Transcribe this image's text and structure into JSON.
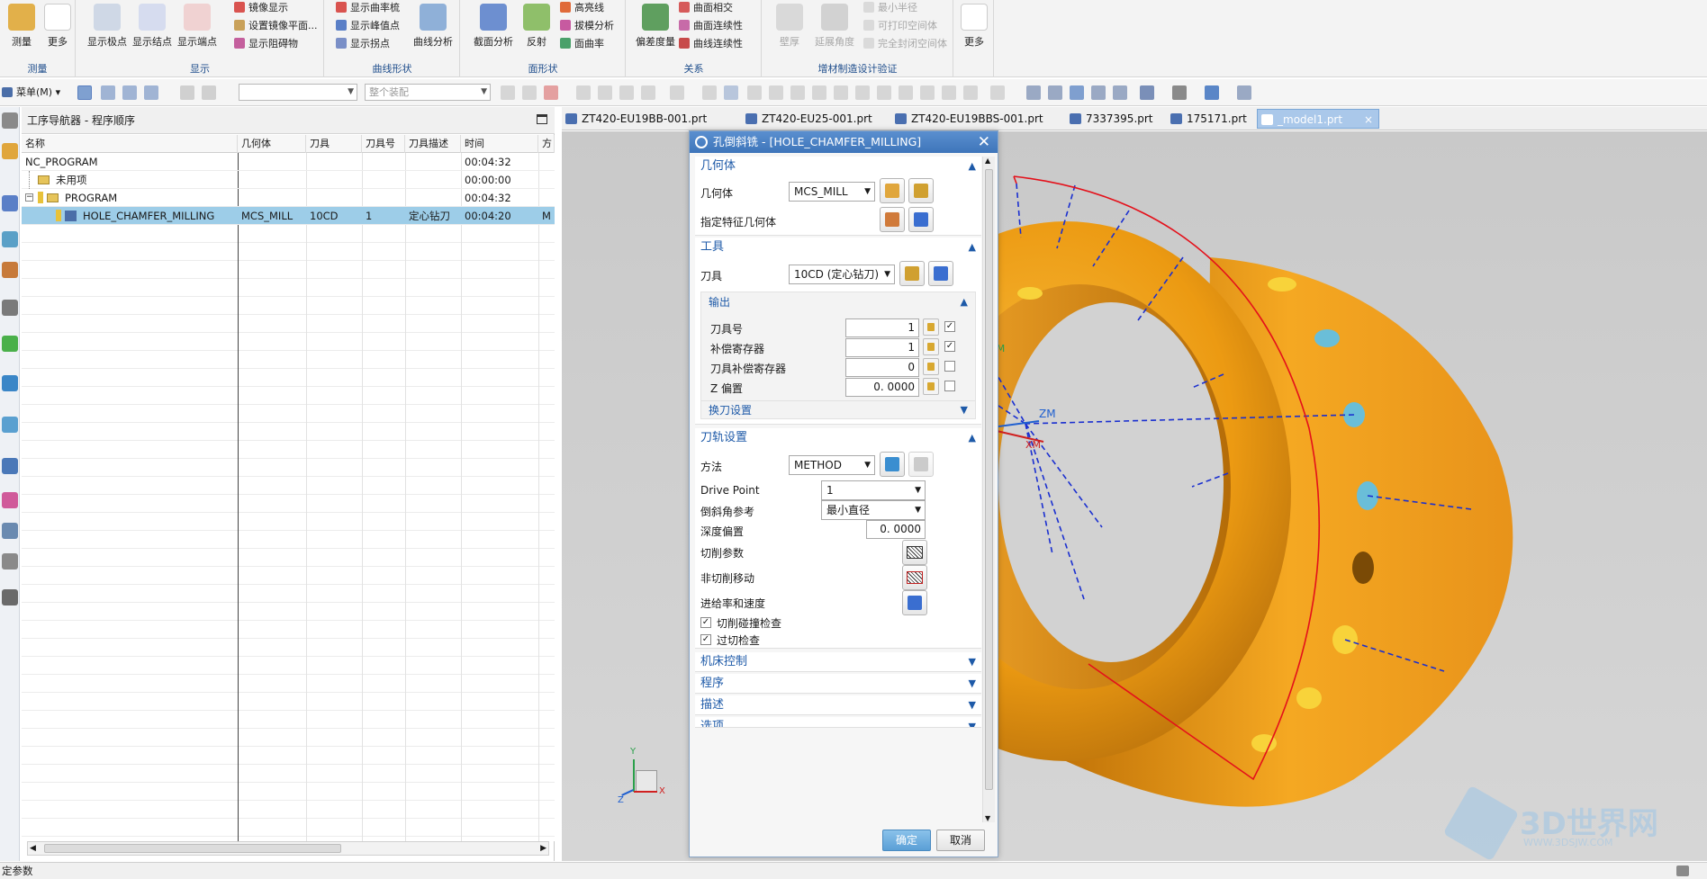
{
  "ribbon": {
    "groups": [
      {
        "label": "测量",
        "big": [
          "测量",
          "更多"
        ]
      },
      {
        "label": "显示",
        "big": [
          "显示极点",
          "显示结点",
          "显示端点"
        ],
        "small": [
          "镜像显示",
          "设置镜像平面...",
          "显示阻碍物"
        ]
      },
      {
        "label": "曲线形状",
        "small": [
          "显示曲率梳",
          "显示峰值点",
          "显示拐点"
        ],
        "big": [
          "曲线分析"
        ]
      },
      {
        "label": "面形状",
        "big": [
          "截面分析",
          "反射"
        ],
        "small": [
          "高亮线",
          "拔模分析",
          "面曲率"
        ]
      },
      {
        "label": "关系",
        "big": [
          "偏差度量"
        ],
        "small": [
          "曲面相交",
          "曲面连续性",
          "曲线连续性"
        ]
      },
      {
        "label": "增材制造设计验证",
        "big": [
          "壁厚",
          "延展角度"
        ],
        "small": [
          "最小半径",
          "可打印空间体",
          "完全封闭空间体"
        ]
      },
      {
        "label": "",
        "big": [
          "更多"
        ]
      }
    ]
  },
  "toolbar": {
    "menu_label": "菜单(M)",
    "filter_combo": "",
    "assembly_combo": "整个装配"
  },
  "navigator": {
    "title": "工序导航器 - 程序顺序",
    "columns": [
      "名称",
      "几何体",
      "刀具",
      "刀具号",
      "刀具描述",
      "时间",
      "方"
    ],
    "rows": [
      {
        "name": "NC_PROGRAM",
        "geometry": "",
        "tool": "",
        "tool_no": "",
        "tool_desc": "",
        "time": "00:04:32",
        "extra": ""
      },
      {
        "name": "未用项",
        "geometry": "",
        "tool": "",
        "tool_no": "",
        "tool_desc": "",
        "time": "00:00:00",
        "extra": ""
      },
      {
        "name": "PROGRAM",
        "geometry": "",
        "tool": "",
        "tool_no": "",
        "tool_desc": "",
        "time": "00:04:32",
        "extra": ""
      },
      {
        "name": "HOLE_CHAMFER_MILLING",
        "geometry": "MCS_MILL",
        "tool": "10CD",
        "tool_no": "1",
        "tool_desc": "定心钻刀",
        "time": "00:04:20",
        "extra": "M"
      }
    ]
  },
  "tabs": [
    {
      "label": "ZT420-EU19BB-001.prt",
      "active": false
    },
    {
      "label": "ZT420-EU25-001.prt",
      "active": false
    },
    {
      "label": "ZT420-EU19BBS-001.prt",
      "active": false
    },
    {
      "label": "7337395.prt",
      "active": false
    },
    {
      "label": "175171.prt",
      "active": false
    },
    {
      "label": "_model1.prt",
      "active": true
    }
  ],
  "dialog": {
    "title": "孔倒斜铣 - [HOLE_CHAMFER_MILLING]",
    "geometry_section": {
      "header": "几何体",
      "geometry_label": "几何体",
      "geometry_value": "MCS_MILL",
      "feature_label": "指定特征几何体"
    },
    "tool_section": {
      "header": "工具",
      "tool_label": "刀具",
      "tool_value": "10CD (定心钻刀)",
      "output_header": "输出",
      "fields": [
        {
          "label": "刀具号",
          "value": "1",
          "checked": true
        },
        {
          "label": "补偿寄存器",
          "value": "1",
          "checked": true
        },
        {
          "label": "刀具补偿寄存器",
          "value": "0",
          "checked": false
        },
        {
          "label": "Z 偏置",
          "value": "0. 0000",
          "checked": false
        }
      ],
      "tool_change_label": "换刀设置"
    },
    "path_section": {
      "header": "刀轨设置",
      "method_label": "方法",
      "method_value": "METHOD",
      "drive_point_label": "Drive Point",
      "drive_point_value": "1",
      "chamfer_ref_label": "倒斜角参考",
      "chamfer_ref_value": "最小直径",
      "depth_offset_label": "深度偏置",
      "depth_offset_value": "0. 0000",
      "cut_params_label": "切削参数",
      "non_cut_label": "非切削移动",
      "feeds_label": "进给率和速度",
      "collision_check_label": "切削碰撞检查",
      "gouge_check_label": "过切检查"
    },
    "collapsed_sections": [
      "机床控制",
      "程序",
      "描述",
      "选项"
    ],
    "ok_label": "确定",
    "cancel_label": "取消"
  },
  "viewport": {
    "axis_labels": {
      "zm": "ZM",
      "ym": "YM",
      "xm": "XM",
      "y": "Y",
      "x": "X",
      "z": "Z"
    },
    "watermark": "3D世界网",
    "watermark_url": "WWW.3DSJW.COM",
    "colors": {
      "part": "#f0a21a",
      "toolpath": "#1a2fd0",
      "boundary": "#e4101a",
      "background": "#d1d1d1"
    }
  },
  "status": {
    "text": "定参数"
  }
}
